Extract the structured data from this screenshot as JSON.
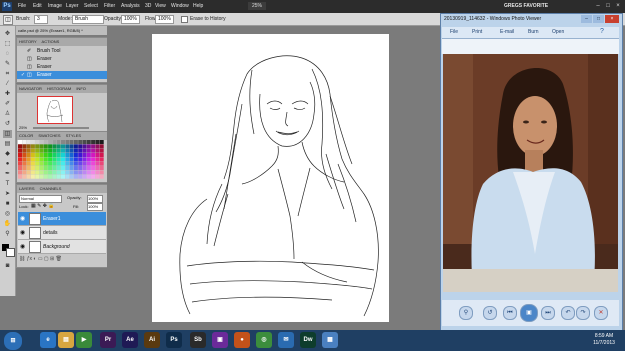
{
  "menubar": {
    "logo": "Ps",
    "items": [
      "File",
      "Edit",
      "Image",
      "Layer",
      "Select",
      "Filter",
      "Analysis",
      "3D",
      "View",
      "Window",
      "Help"
    ],
    "zoom": "25%",
    "workspace": "GREGS FAVORITE",
    "window_controls": [
      "–",
      "□",
      "×"
    ]
  },
  "options": {
    "brush_label": "Brush:",
    "brush_size": "3",
    "mode_label": "Mode:",
    "mode_value": "Brush",
    "opacity_label": "Opacity:",
    "opacity_value": "100%",
    "flow_label": "Flow:",
    "flow_value": "100%",
    "erase_label": "Erase to History"
  },
  "history": {
    "tabs": [
      "HISTORY",
      "ACTIONS"
    ],
    "items": [
      {
        "label": "Brush Tool",
        "selected": false
      },
      {
        "label": "Eraser",
        "selected": false
      },
      {
        "label": "Eraser",
        "selected": false
      },
      {
        "label": "Eraser",
        "selected": true
      }
    ]
  },
  "adjustments": {
    "items": [
      "ADJUSTMENTS",
      "MASKS"
    ]
  },
  "navigator": {
    "tabs": [
      "NAVIGATOR",
      "HISTOGRAM",
      "INFO"
    ],
    "zoom": "25%"
  },
  "swatches": {
    "tabs": [
      "COLOR",
      "SWATCHES",
      "STYLES"
    ]
  },
  "layers": {
    "tabs": [
      "LAYERS",
      "CHANNELS"
    ],
    "blend_mode": "Normal",
    "opacity_label": "Opacity:",
    "opacity_value": "100%",
    "lock_label": "Lock:",
    "fill_label": "Fill:",
    "fill_value": "100%",
    "items": [
      {
        "name": "Eraser1",
        "selected": true
      },
      {
        "name": "details",
        "selected": false
      },
      {
        "name": "Background",
        "selected": false
      }
    ]
  },
  "document": {
    "tab_title": "calle.psd @ 25% (Eraser1, RGB/8) *"
  },
  "viewer": {
    "title": "20130919_114632 - Windows Photo Viewer",
    "menu": [
      "File",
      "Print",
      "E-mail",
      "Burn",
      "Open"
    ],
    "controls": [
      "search-icon",
      "rotate-left-icon",
      "previous-icon",
      "slideshow-icon",
      "next-icon",
      "rotate-counterclockwise-icon",
      "rotate-clockwise-icon",
      "delete-icon"
    ]
  },
  "taskbar": {
    "apps": [
      {
        "name": "start",
        "color": "#2c6fb7",
        "label": "⊞"
      },
      {
        "name": "ie",
        "color": "#2a75c4",
        "label": "e"
      },
      {
        "name": "folder",
        "color": "#d7a640",
        "label": "▤"
      },
      {
        "name": "media",
        "color": "#3a8a3a",
        "label": "▶"
      },
      {
        "name": "premiere",
        "color": "#3b1a55",
        "label": "Pr"
      },
      {
        "name": "after-effects",
        "color": "#1f1a55",
        "label": "Ae"
      },
      {
        "name": "illustrator",
        "color": "#5a3a10",
        "label": "Ai"
      },
      {
        "name": "photoshop",
        "color": "#0f2c4a",
        "label": "Ps"
      },
      {
        "name": "soundbooth",
        "color": "#2a2a2a",
        "label": "Sb"
      },
      {
        "name": "app-purple",
        "color": "#6b2a9a",
        "label": "▣"
      },
      {
        "name": "firefox",
        "color": "#c4521a",
        "label": "●"
      },
      {
        "name": "chrome",
        "color": "#3c8d3c",
        "label": "◎"
      },
      {
        "name": "messenger",
        "color": "#2a6bb0",
        "label": "✉"
      },
      {
        "name": "dreamweaver",
        "color": "#0e3d2c",
        "label": "Dw"
      },
      {
        "name": "photo-viewer",
        "color": "#4a80c0",
        "label": "▦"
      }
    ],
    "time": "8:59 AM",
    "date": "11/7/2013"
  },
  "colors": {
    "selected_layer": "#3b8edb",
    "taskbar": "#1f3f63",
    "viewer_frame": "#bcd3ea"
  }
}
